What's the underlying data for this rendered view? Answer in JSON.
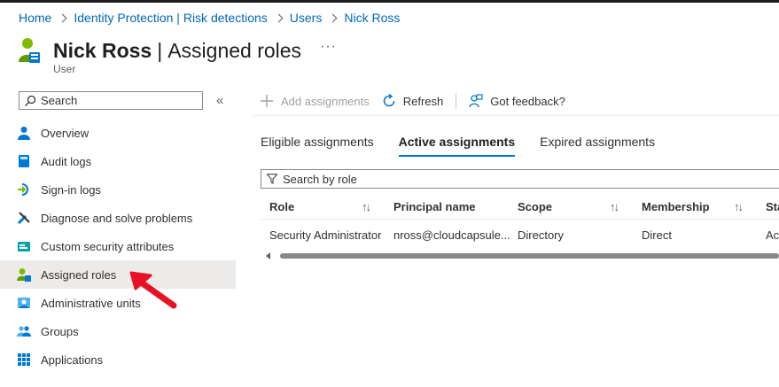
{
  "breadcrumb": [
    "Home",
    "Identity Protection | Risk detections",
    "Users",
    "Nick Ross"
  ],
  "page": {
    "title_name": "Nick Ross",
    "title_sep": "|",
    "title_section": "Assigned roles",
    "more": "···",
    "subtitle": "User"
  },
  "sidebar": {
    "search_placeholder": "Search",
    "collapse": "«",
    "items": [
      {
        "label": "Overview",
        "icon": "person-icon"
      },
      {
        "label": "Audit logs",
        "icon": "book-icon"
      },
      {
        "label": "Sign-in logs",
        "icon": "sign-in-icon"
      },
      {
        "label": "Diagnose and solve problems",
        "icon": "wrench-icon"
      },
      {
        "label": "Custom security attributes",
        "icon": "attribute-icon"
      },
      {
        "label": "Assigned roles",
        "icon": "user-role-icon",
        "active": true
      },
      {
        "label": "Administrative units",
        "icon": "admin-units-icon"
      },
      {
        "label": "Groups",
        "icon": "groups-icon"
      },
      {
        "label": "Applications",
        "icon": "apps-grid-icon"
      }
    ]
  },
  "toolbar": {
    "add": "Add assignments",
    "refresh": "Refresh",
    "feedback": "Got feedback?"
  },
  "tabs": [
    "Eligible assignments",
    "Active assignments",
    "Expired assignments"
  ],
  "active_tab": 1,
  "filter": {
    "placeholder": "Search by role"
  },
  "table": {
    "columns": [
      "Role",
      "Principal name",
      "Scope",
      "Membership",
      "Sta"
    ],
    "sort_glyph": "↑↓",
    "rows": [
      [
        "Security Administrator",
        "nross@cloudcapsule...",
        "Directory",
        "Direct",
        "Ac"
      ]
    ]
  },
  "colors": {
    "accent": "#0078d4",
    "link": "#0067b8",
    "annotation": "#e81123"
  }
}
